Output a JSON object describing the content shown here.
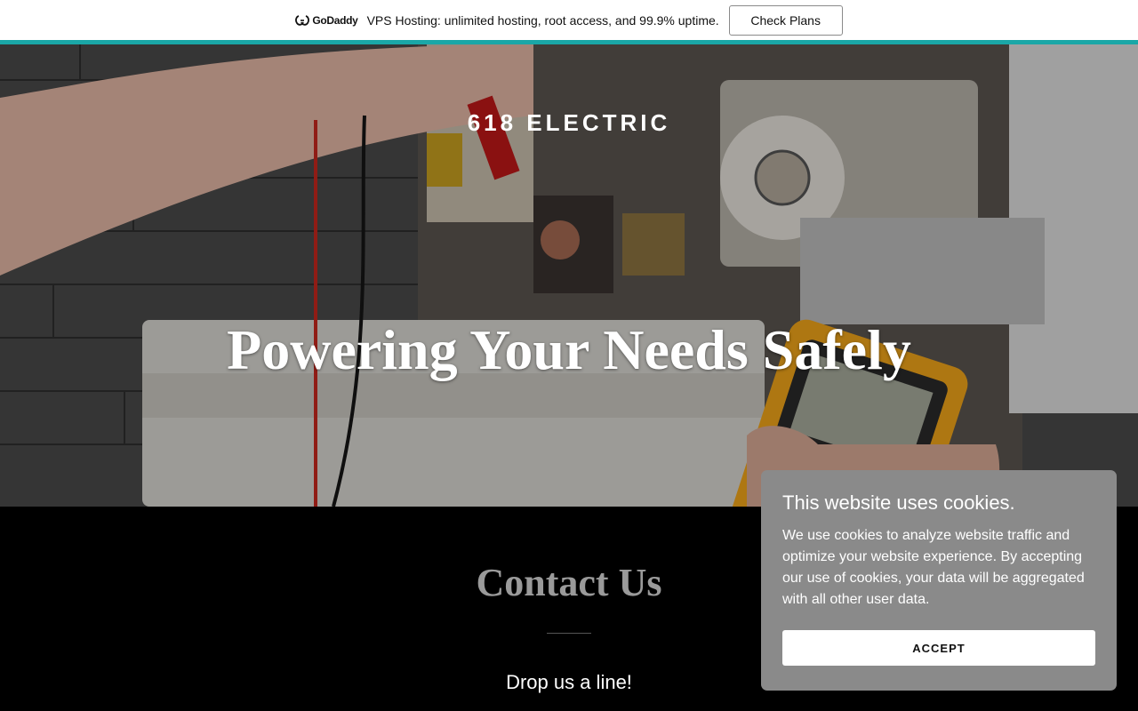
{
  "promo": {
    "logo_text": "GoDaddy",
    "logo_icon": "godaddy-logo-icon",
    "text": "VPS Hosting: unlimited hosting, root access, and 99.9% uptime.",
    "button_label": "Check Plans",
    "accent_color": "#1aa7a7"
  },
  "hero": {
    "site_title": "618 ELECTRIC",
    "heading": "Powering Your Needs Safely",
    "image_description_icon": "electrician-multimeter-photo"
  },
  "contact": {
    "title": "Contact Us",
    "subtitle": "Drop us a line!"
  },
  "cookie": {
    "title": "This website uses cookies.",
    "body": "We use cookies to analyze website traffic and optimize your website experience. By accepting our use of cookies, your data will be aggregated with all other user data.",
    "accept_label": "ACCEPT",
    "background_color": "#8a8a8a"
  }
}
